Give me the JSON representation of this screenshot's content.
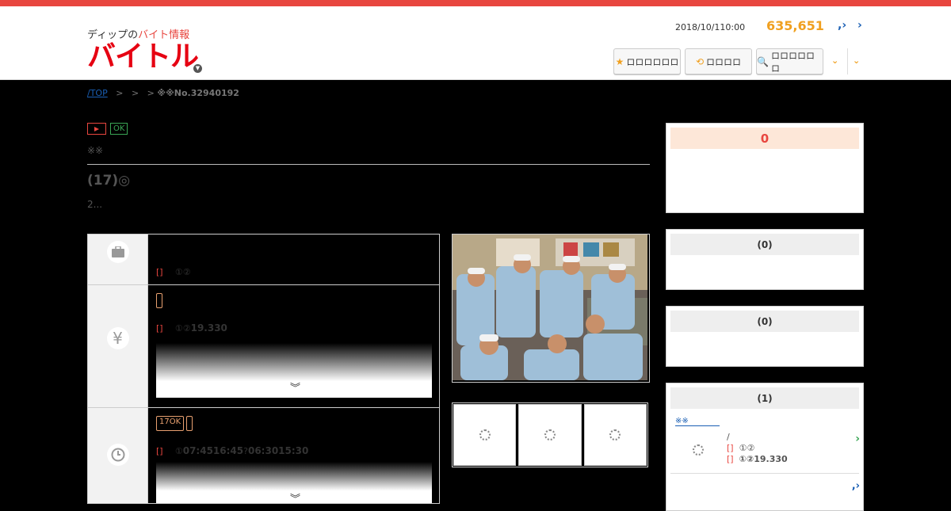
{
  "header": {
    "logo_tagline_pre": "ディップの",
    "logo_tagline_red": "バイト情報",
    "logo_brand": "バイトル",
    "date": "2018/10/110:00",
    "count": "635,651",
    "arrow1": ",›",
    "arrow2": "›",
    "buttons": [
      {
        "icon": "★",
        "label": "ロロロロロロ"
      },
      {
        "icon": "⟲",
        "label": "ロロロロ"
      },
      {
        "icon": "🔍",
        "label": "ロロロロロロ"
      }
    ],
    "down": "⌄"
  },
  "breadcrumb": {
    "top": "/TOP",
    "sep1": ">",
    "sep2": ">",
    "sep3": ">",
    "current": "※※No.32940192"
  },
  "job": {
    "badge_ok": "OK",
    "note": "※※",
    "title": "(17)",
    "title_mark": "◎",
    "subtitle": "2..."
  },
  "rows": [
    {
      "tag": "[]",
      "text": "①②"
    },
    {
      "tag": "[]",
      "text": "①②",
      "value": "19.330"
    },
    {
      "box_label": "17OK",
      "tag": "[]",
      "text": "①",
      "value": "07:4516:45",
      "value2": "06:3015:30",
      "chev": "︾"
    }
  ],
  "fade_chev": "︾",
  "side": {
    "box1_header": "0",
    "box2_header": "(0)",
    "box3_header": "(0)",
    "box4_header": "(1)",
    "box4_link": "※※",
    "box4_line1": "/",
    "box4_tag": "[]",
    "box4_line2": "①②",
    "box4_line3": "①②19.330",
    "box4_more": ",›",
    "chev": "›"
  },
  "colors": {
    "accent": "#e8463f",
    "count": "#f0a020",
    "ok": "#3aa655",
    "link": "#1a5fb4"
  },
  "icons": [
    "briefcase-icon",
    "yen-icon",
    "clock-icon",
    "play-icon",
    "star-icon",
    "history-icon",
    "search-icon",
    "spinner-icon"
  ]
}
